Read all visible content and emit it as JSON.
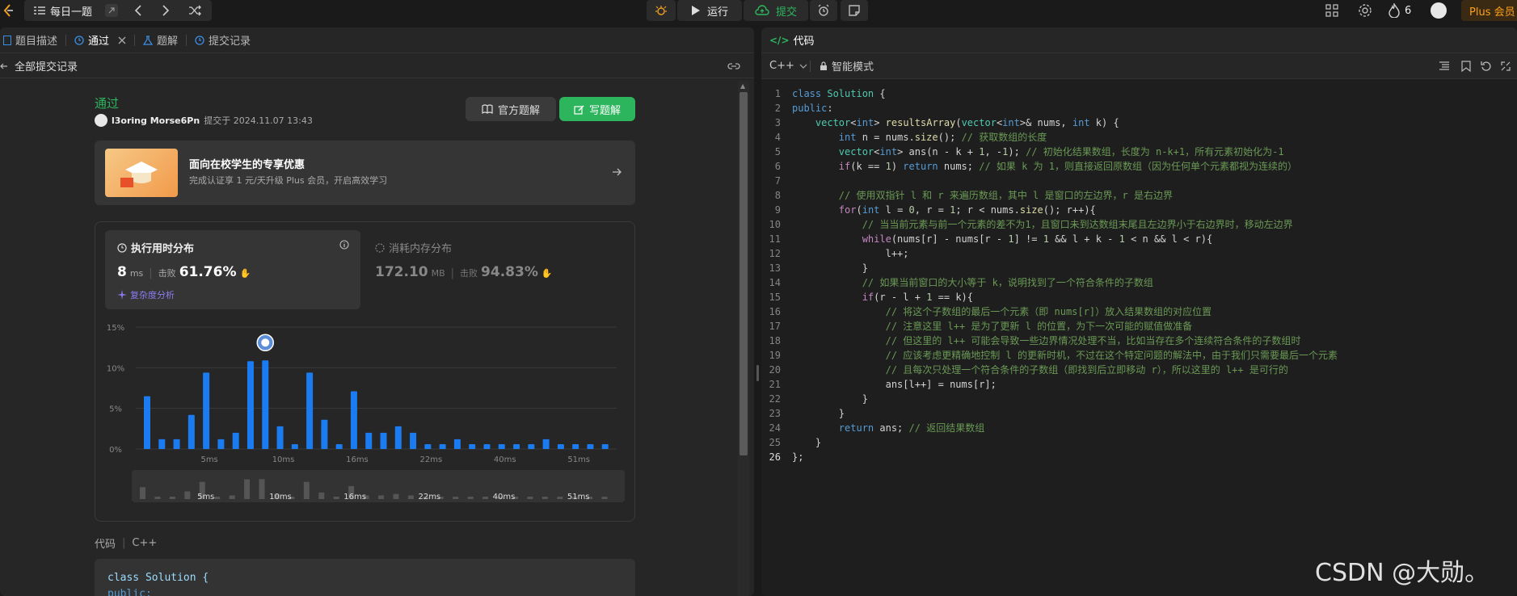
{
  "topbar": {
    "daily_label": "每日一题",
    "run_label": "运行",
    "submit_label": "提交",
    "fire_count": "6",
    "plus_label": "Plus 会员"
  },
  "left": {
    "tabs": [
      {
        "label": "题目描述"
      },
      {
        "label": "通过"
      },
      {
        "label": "题解"
      },
      {
        "label": "提交记录"
      }
    ],
    "back_label": "全部提交记录",
    "status": "通过",
    "user": "l3oring Morse6Pn",
    "submitted_at": "提交于 2024.11.07 13:43",
    "official_btn": "官方题解",
    "write_btn": "写题解",
    "promo_title": "面向在校学生的专享优惠",
    "promo_sub": "完成认证享 1 元/天升级 Plus 会员，开启高效学习",
    "runtime_title": "执行用时分布",
    "runtime_value": "8",
    "runtime_unit": "ms",
    "beat_label": "击败",
    "runtime_beat": "61.76%",
    "complexity_label": "复杂度分析",
    "memory_title": "消耗内存分布",
    "memory_value": "172.10",
    "memory_unit": "MB",
    "memory_beat": "94.83%",
    "code_label": "代码",
    "lang_label": "C++",
    "preview_line1": "class Solution {",
    "preview_line2": "public:"
  },
  "chart_data": {
    "type": "bar",
    "ylabels": [
      "15%",
      "10%",
      "5%",
      "0%"
    ],
    "xlabels": [
      "5ms",
      "10ms",
      "16ms",
      "22ms",
      "40ms",
      "51ms"
    ],
    "ylim": [
      0,
      15
    ],
    "values": [
      6.5,
      1.2,
      1.2,
      4.2,
      9.4,
      1.2,
      2.0,
      10.8,
      10.9,
      2.8,
      0.6,
      9.4,
      3.6,
      0.6,
      7.1,
      2.0,
      2.0,
      2.8,
      2.0,
      0.6,
      0.6,
      1.2,
      0.6,
      0.6,
      0.6,
      0.6,
      0.6,
      1.2,
      0.6,
      0.6,
      0.6,
      0.6
    ],
    "highlight_index": 8
  },
  "right": {
    "title": "代码",
    "lang": "C++",
    "mode": "智能模式",
    "lines": [
      "class Solution {",
      "public:",
      "    vector<int> resultsArray(vector<int>& nums, int k) {",
      "        int n = nums.size(); // 获取数组的长度",
      "        vector<int> ans(n - k + 1, -1); // 初始化结果数组，长度为 n-k+1，所有元素初始化为-1",
      "        if(k == 1) return nums; // 如果 k 为 1，则直接返回原数组（因为任何单个元素都视为连续的）",
      "",
      "        // 使用双指针 l 和 r 来遍历数组，其中 l 是窗口的左边界，r 是右边界",
      "        for(int l = 0, r = 1; r < nums.size(); r++){",
      "            // 当当前元素与前一个元素的差不为1，且窗口未到达数组末尾且左边界小于右边界时，移动左边界",
      "            while(nums[r] - nums[r - 1] != 1 && l + k - 1 < n && l < r){",
      "                l++;",
      "            }",
      "            // 如果当前窗口的大小等于 k，说明找到了一个符合条件的子数组",
      "            if(r - l + 1 == k){",
      "                // 将这个子数组的最后一个元素（即 nums[r]）放入结果数组的对应位置",
      "                // 注意这里 l++ 是为了更新 l 的位置，为下一次可能的赋值做准备",
      "                // 但这里的 l++ 可能会导致一些边界情况处理不当，比如当存在多个连续符合条件的子数组时",
      "                // 应该考虑更精确地控制 l 的更新时机，不过在这个特定问题的解法中，由于我们只需要最后一个元素",
      "                // 且每次只处理一个符合条件的子数组（即找到后立即移动 r），所以这里的 l++ 是可行的",
      "                ans[l++] = nums[r];",
      "            }",
      "        }",
      "        return ans; // 返回结果数组",
      "    }",
      "};"
    ]
  },
  "watermark": "CSDN @大勋。"
}
